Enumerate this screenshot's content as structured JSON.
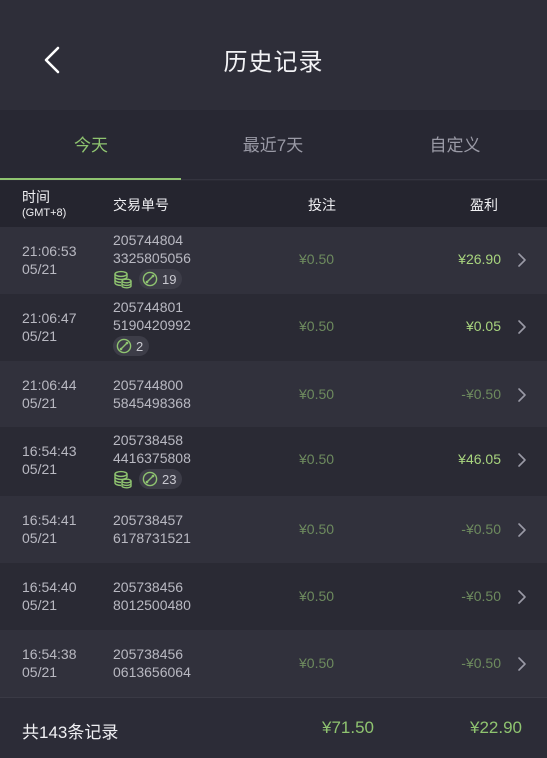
{
  "header": {
    "title": "历史记录"
  },
  "tabs": [
    {
      "label": "今天"
    },
    {
      "label": "最近7天"
    },
    {
      "label": "自定义"
    }
  ],
  "columns": {
    "time": "时间",
    "time_sub": "(GMT+8)",
    "order": "交易单号",
    "bet": "投注",
    "profit": "盈利"
  },
  "rows": [
    {
      "time": "21:06:53",
      "date": "05/21",
      "order1": "205744804",
      "order2": "3325805056",
      "bet": "¥0.50",
      "profit": "¥26.90",
      "profit_positive": true,
      "coins": true,
      "link_count": "19"
    },
    {
      "time": "21:06:47",
      "date": "05/21",
      "order1": "205744801",
      "order2": "5190420992",
      "bet": "¥0.50",
      "profit": "¥0.05",
      "profit_positive": true,
      "coins": false,
      "link_count": "2"
    },
    {
      "time": "21:06:44",
      "date": "05/21",
      "order1": "205744800",
      "order2": "5845498368",
      "bet": "¥0.50",
      "profit": "-¥0.50",
      "profit_positive": false,
      "coins": false,
      "link_count": null
    },
    {
      "time": "16:54:43",
      "date": "05/21",
      "order1": "205738458",
      "order2": "4416375808",
      "bet": "¥0.50",
      "profit": "¥46.05",
      "profit_positive": true,
      "coins": true,
      "link_count": "23"
    },
    {
      "time": "16:54:41",
      "date": "05/21",
      "order1": "205738457",
      "order2": "6178731521",
      "bet": "¥0.50",
      "profit": "-¥0.50",
      "profit_positive": false,
      "coins": false,
      "link_count": null
    },
    {
      "time": "16:54:40",
      "date": "05/21",
      "order1": "205738456",
      "order2": "8012500480",
      "bet": "¥0.50",
      "profit": "-¥0.50",
      "profit_positive": false,
      "coins": false,
      "link_count": null
    },
    {
      "time": "16:54:38",
      "date": "05/21",
      "order1": "205738456",
      "order2": "0613656064",
      "bet": "¥0.50",
      "profit": "-¥0.50",
      "profit_positive": false,
      "coins": false,
      "link_count": null
    }
  ],
  "footer": {
    "total_label": "共143条记录",
    "total_bet": "¥71.50",
    "total_profit": "¥22.90"
  },
  "colors": {
    "accent": "#8fc470",
    "profit_positive": "#a8d47e",
    "muted_green": "#6d8a5e",
    "background": "#2a2a34"
  },
  "icons": {
    "back": "chevron-left-icon",
    "row_arrow": "chevron-right-icon",
    "coins": "coin-stack-icon",
    "link": "link-icon"
  }
}
